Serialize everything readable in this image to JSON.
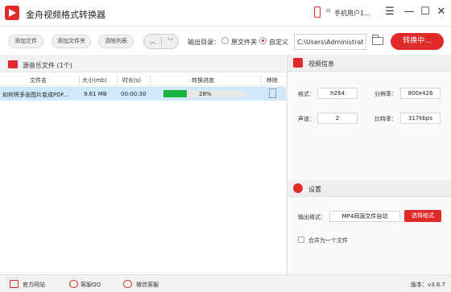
{
  "app": {
    "title": "金舟视频格式转换器",
    "user_label": "手机用户1...",
    "minimize_glyph": "—",
    "maximize_glyph": "☐",
    "close_glyph": "✕",
    "wifi_glyph": "≋"
  },
  "toolbar": {
    "add_file": "添加文件",
    "add_folder": "添加文件夹",
    "clear_list": "清除列表",
    "up_glyph": "︿",
    "down_glyph": "﹀",
    "output_dir_label": "输出目录：",
    "option_source_folder": "原文件夹",
    "option_custom": "自定义",
    "output_path": "C:\\Users\\Administrator",
    "convert_button": "转换中..."
  },
  "file_list": {
    "title": "源音乐文件 (1个)",
    "columns": [
      "文件名",
      "大小(mb)",
      "时长(s)",
      "转换进度",
      "移除"
    ],
    "rows": [
      {
        "name": "如何将多张图片变成PDF...",
        "size": "9.61 MB",
        "duration": "00:00:30",
        "progress_label": "28%",
        "progress": 0.28
      }
    ]
  },
  "video_info": {
    "title": "视频信息",
    "format_label": "格式：",
    "format_value": "h264",
    "resolution_label": "分辨率：",
    "resolution_value": "800x426",
    "channels_label": "声道：",
    "channels_value": "2",
    "bitrate_label": "比特率：",
    "bitrate_value": "317kbps"
  },
  "settings": {
    "title": "设置",
    "output_format_label": "输出格式：",
    "output_format_value": "MP4同源文件自动",
    "choose_format_button": "选择格式",
    "merge_label": "合并为一个文件"
  },
  "statusbar": {
    "website": "官方网站",
    "qq_support": "客服QQ",
    "wechat_support": "微信客服",
    "version": "版本：v3.6.7"
  },
  "colors": {
    "accent": "#e02a2a",
    "progress": "#19b23b",
    "selected_row": "#cfe8fb"
  }
}
